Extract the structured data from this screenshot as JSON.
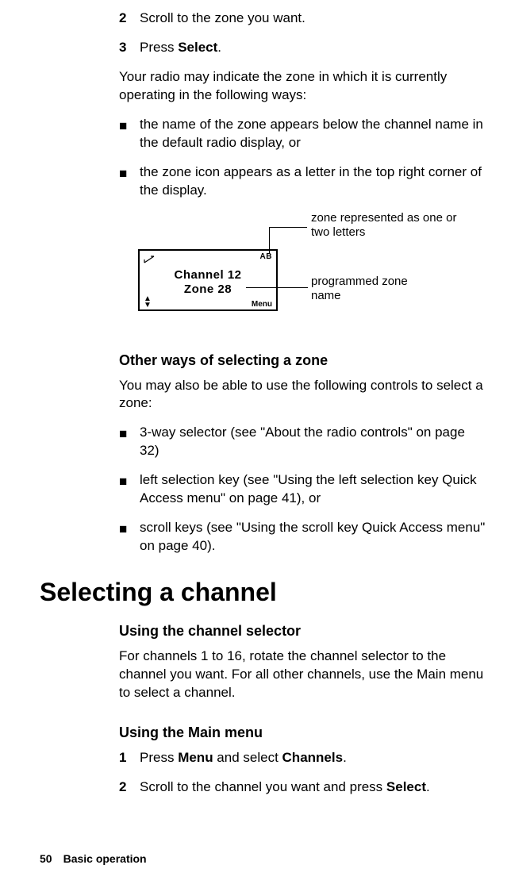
{
  "steps_top": [
    {
      "num": "2",
      "text": "Scroll to the zone you want."
    },
    {
      "num": "3",
      "text_before": " Press ",
      "bold": "Select",
      "text_after": "."
    }
  ],
  "intro_para": "Your radio may indicate the zone in which it is currently operating in the following ways:",
  "bullets_a": [
    "the name of the zone appears below the channel name in the default radio display, or",
    "the zone icon appears as a letter in the top right corner of the display."
  ],
  "lcd": {
    "top_right": "AB",
    "line1": "Channel 12",
    "line2": "Zone 28",
    "menu": "Menu"
  },
  "callout1": "zone represented as one or two letters",
  "callout2": "programmed zone name",
  "subhead_other": "Other ways of selecting a zone",
  "other_para": "You may also be able to use the following controls to select a zone:",
  "bullets_b": [
    "3-way selector (see \"About the radio controls\" on page 32)",
    "left selection key (see \"Using the left selection key Quick Access menu\" on page 41), or",
    "scroll keys (see \"Using the scroll key Quick Access menu\" on page 40)."
  ],
  "h1": "Selecting a channel",
  "subhead_selector": "Using the channel selector",
  "selector_para": "For channels 1 to 16, rotate the channel selector to the channel you want. For all other channels, use the Main menu to select a channel.",
  "subhead_main": "Using the Main menu",
  "steps_main": {
    "s1": {
      "num": "1",
      "pre": "Press ",
      "b1": "Menu",
      "mid": " and select ",
      "b2": "Channels",
      "post": "."
    },
    "s2": {
      "num": "2",
      "pre": "Scroll to the channel you want and press ",
      "b1": "Select",
      "post": "."
    }
  },
  "footer": {
    "page": "50",
    "section": "Basic operation"
  }
}
